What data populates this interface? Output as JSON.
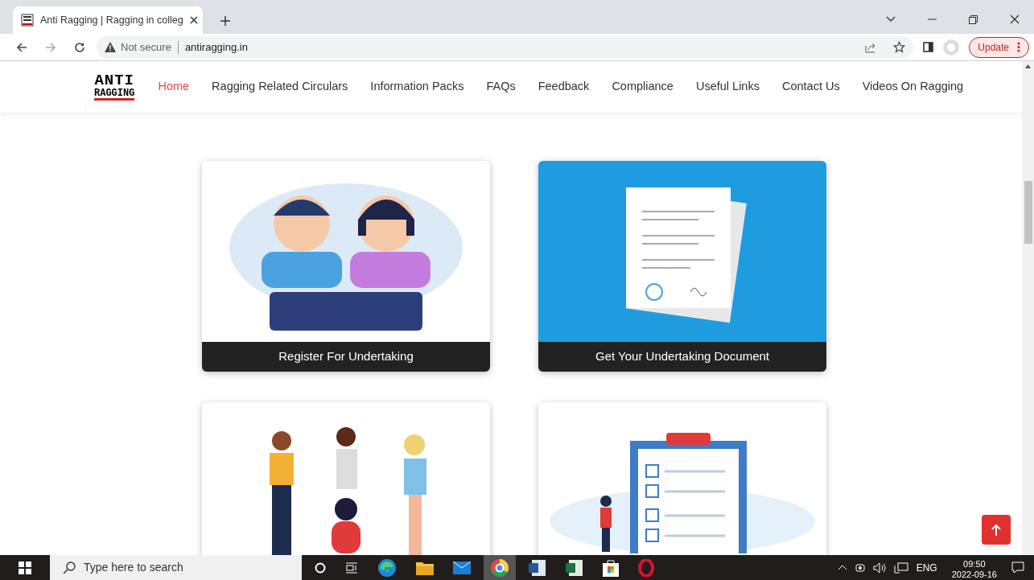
{
  "browser": {
    "tabs": [
      {
        "title": "Anti Ragging | Ragging in colleg",
        "selected": true
      }
    ],
    "security": "Not secure",
    "url": "antiragging.in",
    "update_label": "Update"
  },
  "site": {
    "logo": {
      "top": "ANTI",
      "bottom": "RAGGING"
    },
    "nav": [
      {
        "label": "Home",
        "selected": true
      },
      {
        "label": "Ragging Related Circulars",
        "selected": false
      },
      {
        "label": "Information Packs",
        "selected": false
      },
      {
        "label": "FAQs",
        "selected": false
      },
      {
        "label": "Feedback",
        "selected": false
      },
      {
        "label": "Compliance",
        "selected": false
      },
      {
        "label": "Useful Links",
        "selected": false
      },
      {
        "label": "Contact Us",
        "selected": false
      },
      {
        "label": "Videos On Ragging",
        "selected": false
      }
    ],
    "cards": [
      {
        "kind": "kids",
        "caption": "Register For Undertaking"
      },
      {
        "kind": "papers",
        "caption": "Get Your Undertaking Document"
      },
      {
        "kind": "group"
      },
      {
        "kind": "checklist"
      }
    ]
  },
  "taskbar": {
    "search_placeholder": "Type here to search",
    "language": "ENG",
    "time": "09:50",
    "date": "2022-09-16"
  }
}
